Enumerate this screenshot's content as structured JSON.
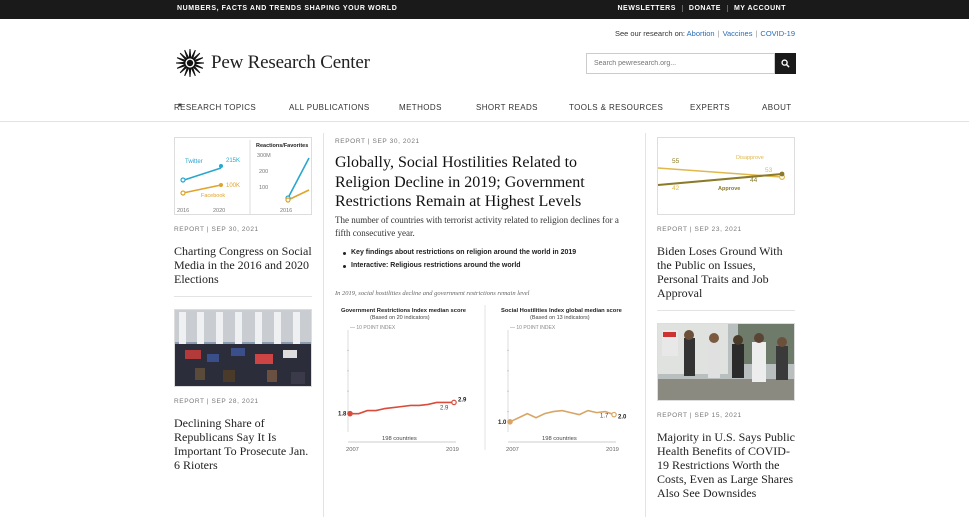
{
  "topbar": {
    "tagline": "NUMBERS, FACTS AND TRENDS SHAPING YOUR WORLD",
    "links": [
      "NEWSLETTERS",
      "DONATE",
      "MY ACCOUNT"
    ]
  },
  "header": {
    "research_prefix": "See our research on:",
    "research_links": [
      "Abortion",
      "Vaccines",
      "COVID-19"
    ],
    "logo_text": "Pew Research Center",
    "search_placeholder": "Search pewresearch.org..."
  },
  "nav": {
    "items": [
      "RESEARCH TOPICS",
      "ALL PUBLICATIONS",
      "METHODS",
      "SHORT READS",
      "TOOLS & RESOURCES",
      "EXPERTS",
      "ABOUT"
    ]
  },
  "left": {
    "card1": {
      "meta": "REPORT | SEP 30, 2021",
      "headline": "Charting Congress on Social Media in the 2016 and 2020 Elections",
      "thumb": {
        "twitter": "Twitter",
        "twitter_val": "215K",
        "facebook": "Facebook",
        "facebook_val": "100K",
        "year_a": "2016",
        "year_b": "2020",
        "panel_title": "Reactions/Favorites",
        "ticks": [
          "300M",
          "200",
          "100"
        ],
        "year_c": "2016"
      }
    },
    "card2": {
      "meta": "REPORT | SEP 28, 2021",
      "headline": "Declining Share of Republicans Say It Is Important To Prosecute Jan. 6 Rioters"
    }
  },
  "feature": {
    "meta": "REPORT | SEP 30, 2021",
    "title": "Globally, Social Hostilities Related to Religion Decline in 2019; Government Restrictions Remain at Highest Levels",
    "dek": "The number of countries with terrorist activity related to religion declines for a fifth consecutive year.",
    "links": [
      "Key findings about restrictions on religion around the world in 2019",
      "Interactive: Religious restrictions around the world"
    ],
    "caption": "In 2019, social hostilities decline and government restrictions remain level"
  },
  "chart_data": [
    {
      "type": "line",
      "title": "Government Restrictions Index median score",
      "subtitle": "(Based on 20 indicators)",
      "ylabel": "10 POINT INDEX",
      "x": [
        2007,
        2008,
        2009,
        2010,
        2011,
        2012,
        2013,
        2014,
        2015,
        2016,
        2017,
        2018,
        2019
      ],
      "values": [
        1.8,
        1.8,
        2.1,
        2.1,
        2.3,
        2.4,
        2.5,
        2.6,
        2.6,
        2.7,
        2.9,
        2.9,
        2.9
      ],
      "xticks": [
        "2007",
        "2019"
      ],
      "labels": [
        "1.8",
        "2.9",
        "2.9"
      ],
      "annotation": "198 countries",
      "color": "#d94c3c",
      "ylim": [
        0,
        10
      ]
    },
    {
      "type": "line",
      "title": "Social Hostilities Index global median score",
      "subtitle": "(Based on 13 indicators)",
      "ylabel": "10 POINT INDEX",
      "x": [
        2007,
        2008,
        2009,
        2010,
        2011,
        2012,
        2013,
        2014,
        2015,
        2016,
        2017,
        2018,
        2019
      ],
      "values": [
        1.0,
        1.4,
        1.8,
        1.4,
        1.8,
        2.0,
        2.1,
        1.9,
        1.7,
        2.1,
        1.9,
        2.0,
        1.7
      ],
      "xticks": [
        "2007",
        "2019"
      ],
      "labels": [
        "1.0",
        "2.0",
        "1.7"
      ],
      "annotation": "198 countries",
      "color": "#d9a566",
      "ylim": [
        0,
        10
      ]
    }
  ],
  "right": {
    "card1": {
      "meta": "REPORT | SEP 23, 2021",
      "headline": "Biden Loses Ground With the Public on Issues, Personal Traits and Job Approval",
      "thumb": {
        "val_a": "55",
        "val_b": "42",
        "disapprove": "Disapprove",
        "approve": "Approve",
        "end_a": "53",
        "end_b": "44"
      }
    },
    "card2": {
      "meta": "REPORT | SEP 15, 2021",
      "headline": "Majority in U.S. Says Public Health Benefits of COVID-19 Restrictions Worth the Costs, Even as Large Shares Also See Downsides"
    }
  },
  "colors": {
    "topbar": "#1a1a1a",
    "link": "#2a6db5",
    "twitter": "#2aa6cf",
    "facebook": "#e0a32b",
    "gov_line": "#d94c3c",
    "soc_line": "#d9a566",
    "approve": "#8a7a2a",
    "disapprove": "#e0b84c"
  }
}
